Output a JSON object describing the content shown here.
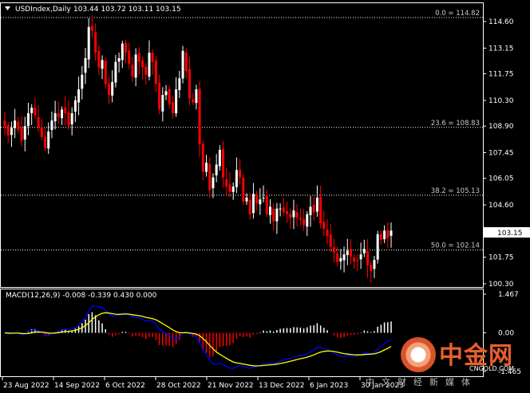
{
  "header": {
    "symbol": "USDIndex,Daily",
    "ohlc": "103.44 103.72 103.11 103.15"
  },
  "macd": {
    "label": "MACD(12,26,9) -0.008 -0.339 0.430 0.000",
    "axis_ticks": [
      "1.467",
      "0.00",
      "-1.465"
    ],
    "ylim": [
      -1.465,
      1.467
    ],
    "signal_color": "#ffff00",
    "main_color": "#0000ff",
    "histogram_color_positive": "#ffffff",
    "histogram_color_negative": "#ff0000"
  },
  "watermark": {
    "name": "中金网",
    "url": "CNGOLD.COM",
    "tagline": "中文财经新媒体"
  },
  "colors": {
    "background": "#000000",
    "bull_candle": "#ffffff",
    "bear_candle": "#ff0000",
    "fib_line": "#ffffff",
    "current_price_box": "#ffffff"
  },
  "chart_data": {
    "type": "candlestick",
    "title": "USDIndex,Daily",
    "current_price": 103.15,
    "ylim": [
      100.0,
      115.2
    ],
    "y_ticks": [
      114.6,
      113.15,
      111.75,
      110.3,
      108.9,
      107.45,
      106.05,
      104.6,
      103.15,
      101.75,
      100.3
    ],
    "y_tick_labels": [
      "114.60",
      "113.15",
      "111.75",
      "110.30",
      "108.90",
      "107.45",
      "106.05",
      "104.60",
      "103.15",
      "101.75",
      "100.30"
    ],
    "x_tick_labels": [
      "23 Aug 2022",
      "14 Sep 2022",
      "6 Oct 2022",
      "28 Oct 2022",
      "21 Nov 2022",
      "13 Dec 2022",
      "6 Jan 2023",
      "30 Jan 2023"
    ],
    "fibonacci": [
      {
        "label": "0.0 = 114.82",
        "value": 114.82
      },
      {
        "label": "23.6 = 108.83",
        "value": 108.83
      },
      {
        "label": "38.2 = 105.13",
        "value": 105.13
      },
      {
        "label": "50.0 = 102.14",
        "value": 102.14
      }
    ],
    "closes": [
      108.9,
      108.4,
      108.8,
      109.2,
      108.7,
      108.1,
      108.9,
      109.6,
      109.9,
      109.5,
      108.8,
      108.3,
      107.7,
      108.6,
      109.2,
      109.6,
      109.4,
      109.8,
      109.6,
      108.9,
      109.6,
      110.3,
      110.9,
      111.7,
      112.6,
      114.3,
      114.1,
      112.9,
      112.1,
      112.5,
      111.2,
      110.6,
      111.3,
      112.4,
      112.6,
      113.4,
      112.9,
      112.3,
      111.6,
      112.8,
      112.4,
      112.1,
      111.7,
      112.9,
      112.4,
      111.2,
      109.8,
      110.6,
      110.8,
      110.1,
      109.6,
      110.9,
      111.5,
      113.0,
      111.9,
      110.4,
      110.2,
      110.9,
      107.9,
      106.4,
      106.9,
      105.4,
      106.1,
      106.8,
      107.6,
      106.1,
      105.6,
      105.3,
      105.6,
      106.5,
      106.1,
      104.8,
      105.0,
      104.1,
      105.2,
      104.7,
      104.9,
      105.0,
      104.1,
      104.5,
      103.7,
      104.4,
      104.4,
      104.2,
      104.1,
      103.9,
      104.3,
      103.9,
      103.8,
      103.5,
      104.1,
      104.5,
      104.2,
      105.0,
      103.6,
      103.3,
      102.9,
      102.3,
      102.0,
      101.5,
      101.7,
      101.9,
      102.1,
      101.8,
      101.5,
      101.6,
      101.9,
      102.2,
      101.3,
      101.0,
      101.6,
      103.0,
      102.7,
      103.2,
      102.8,
      103.2
    ]
  }
}
